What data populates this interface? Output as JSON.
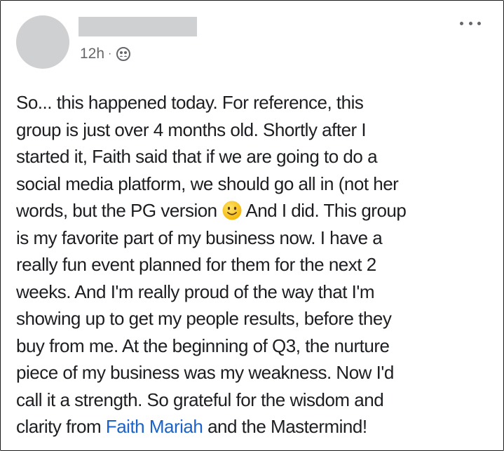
{
  "post": {
    "timestamp": "12h",
    "separator": "·",
    "audience_icon": "group-audience-icon",
    "more_icon": "more-options-icon",
    "body": {
      "line_1": "So... this happened today. For reference, this",
      "line_2": "group is just over 4 months old. Shortly after I",
      "line_3": "started it, Faith said that if we are going to do a",
      "line_4": "social media platform, we should go all in (not her",
      "line_5_before_emoji": "words, but the PG version ",
      "emoji": "slightly-smiling-face",
      "line_5_after_emoji": "And I did. This group",
      "line_6": "is my favorite part of my business now. I have a",
      "line_7": "really fun event planned for them for the next 2",
      "line_8": "weeks. And I'm really proud of the way that I'm",
      "line_9": "showing up to get my people results, before they",
      "line_10": "buy from me. At the beginning of Q3, the nurture",
      "line_11": "piece of my business was my weakness. Now I'd",
      "line_12": "call it a strength. So grateful for the wisdom and",
      "line_13_before_mention": "clarity from ",
      "mention": "Faith Mariah",
      "line_13_after_mention": " and the Mastermind!"
    }
  },
  "colors": {
    "mention": "#1d62c6",
    "meta": "#65676b",
    "redaction": "#cfd0d2"
  }
}
